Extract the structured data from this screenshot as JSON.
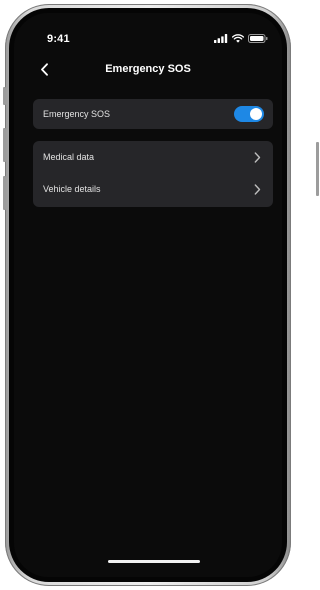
{
  "status_bar": {
    "time": "9:41",
    "icons": [
      "signal-icon",
      "wifi-icon",
      "battery-icon"
    ]
  },
  "header": {
    "back_icon": "chevron-left-icon",
    "title": "Emergency SOS"
  },
  "sos_setting": {
    "label": "Emergency SOS",
    "enabled": true
  },
  "details": {
    "items": [
      {
        "label": "Medical data",
        "icon": "chevron-right-icon"
      },
      {
        "label": "Vehicle details",
        "icon": "chevron-right-icon"
      }
    ]
  },
  "colors": {
    "background": "#0b0b0b",
    "card": "#262629",
    "accent": "#1e88e5",
    "text": "#ffffff"
  }
}
